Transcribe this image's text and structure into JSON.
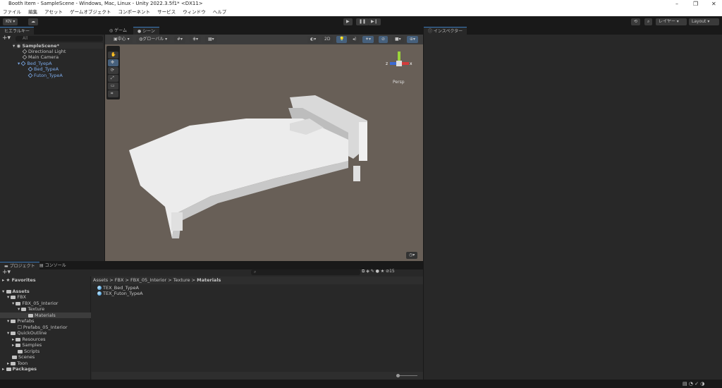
{
  "window": {
    "title": "Booth Item - SampleScene - Windows, Mac, Linux - Unity 2022.3.5f1* <DX11>",
    "minimize": "–",
    "maximize": "❐",
    "close": "✕"
  },
  "menu": [
    "ファイル",
    "編集",
    "アセット",
    "ゲームオブジェクト",
    "コンポーネント",
    "サービス",
    "ウィンドウ",
    "ヘルプ"
  ],
  "toolbar": {
    "account": "KN ▾",
    "layers": "レイヤー",
    "layout": "Layout"
  },
  "hierarchy": {
    "tab": "ヒエラルキー",
    "search_placeholder": "All",
    "scene": "SampleScene*",
    "items": [
      {
        "label": "Directional Light"
      },
      {
        "label": "Main Camera"
      },
      {
        "label": "Bed_TyepA"
      },
      {
        "label": "Bed_TypeA"
      },
      {
        "label": "Futon_TypeA"
      }
    ]
  },
  "scene_view": {
    "tabs": [
      "ゲーム",
      "シーン"
    ],
    "pivot": "中心",
    "space": "グローバル",
    "mode_2d": "2D",
    "persp": "Persp",
    "axis_x": "x",
    "axis_z": "z"
  },
  "inspector": {
    "tab": "インスペクター"
  },
  "project": {
    "tabs": [
      "プロジェクト",
      "コンソール"
    ],
    "favorites": "Favorites",
    "tree": [
      {
        "label": "Assets"
      },
      {
        "label": "FBX"
      },
      {
        "label": "FBX_05_Interior"
      },
      {
        "label": "Texture"
      },
      {
        "label": "Materials"
      },
      {
        "label": "Prefabs"
      },
      {
        "label": "Prefabs_05_Interior"
      },
      {
        "label": "QuickOutline"
      },
      {
        "label": "Resources"
      },
      {
        "label": "Samples"
      },
      {
        "label": "Scripts"
      },
      {
        "label": "Scenes"
      },
      {
        "label": "Toon"
      },
      {
        "label": "Packages"
      }
    ],
    "breadcrumb": [
      "Assets",
      "FBX",
      "FBX_05_Interior",
      "Texture",
      "Materials"
    ],
    "files": [
      {
        "label": "TEX_Bed_TypeA"
      },
      {
        "label": "TEX_Futon_TypeA"
      }
    ],
    "hidden_count": "15"
  }
}
